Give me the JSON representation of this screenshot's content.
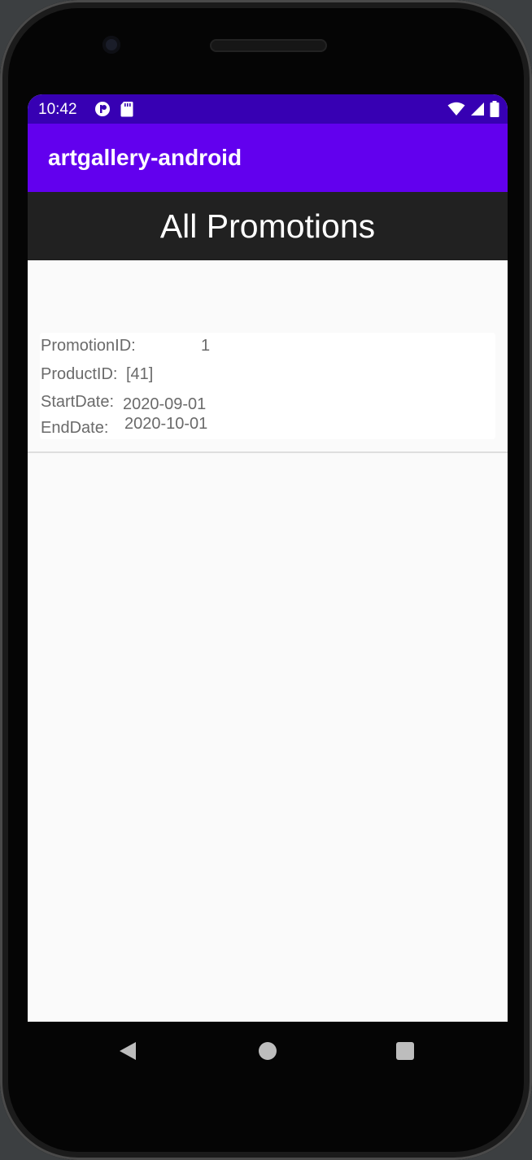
{
  "status_bar": {
    "time": "10:42",
    "left_icons": [
      "notification-icon",
      "sd-card-icon"
    ],
    "right_icons": [
      "wifi-icon",
      "cellular-icon",
      "battery-icon"
    ],
    "color": "#3700b3"
  },
  "app_bar": {
    "title": "artgallery-android",
    "color": "#6200ee"
  },
  "header": {
    "title": "All Promotions",
    "color": "#212121"
  },
  "promotions": [
    {
      "promotion_id_label": "PromotionID:",
      "promotion_id": "1",
      "product_id_label": "ProductID:",
      "product_id": "[41]",
      "start_date_label": "StartDate:",
      "start_date": "2020-09-01",
      "end_date_label": "EndDate:",
      "end_date": "2020-10-01"
    }
  ],
  "navigation_bar": {
    "buttons": [
      "back-icon",
      "home-icon",
      "recents-icon"
    ]
  }
}
